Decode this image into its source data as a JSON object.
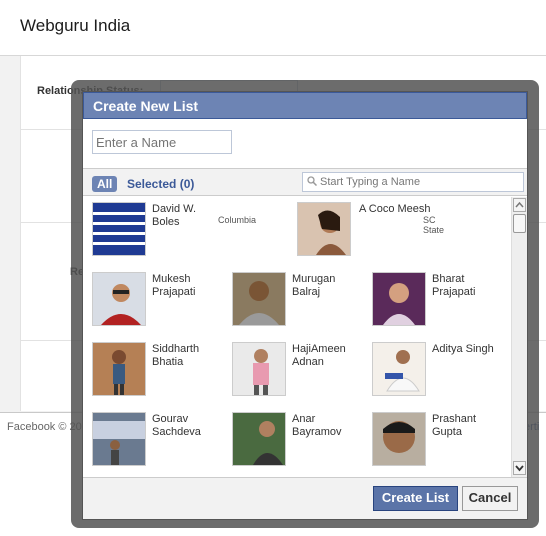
{
  "page": {
    "title": "Webguru India",
    "bg_label_1": "Relationship Status:",
    "bg_label_2": "Re",
    "footer_left": "Facebook © 20",
    "footer_right": "erti"
  },
  "dialog": {
    "title": "Create New List",
    "name_placeholder": "Enter a Name",
    "tab_all": "All",
    "tab_selected": "Selected (0)",
    "search_placeholder": "Start Typing a Name",
    "create_button": "Create List",
    "cancel_button": "Cancel"
  },
  "friends": [
    {
      "name": "David W. Boles",
      "network": "Columbia",
      "avatar": "lines-logo"
    },
    {
      "name": "A Coco Meesh",
      "network": "SC State",
      "avatar": "woman-photo"
    },
    {
      "name": "Mukesh Prajapati",
      "network": "",
      "avatar": "man-sunglasses-photo"
    },
    {
      "name": "Murugan Balraj",
      "network": "",
      "avatar": "man-photo"
    },
    {
      "name": "Bharat Prajapati",
      "network": "",
      "avatar": "child-photo"
    },
    {
      "name": "Siddharth Bhatia",
      "network": "",
      "avatar": "man-photo"
    },
    {
      "name": "HajiAmeen Adnan",
      "network": "",
      "avatar": "man-pink-shirt-photo"
    },
    {
      "name": "Aditya Singh",
      "network": "",
      "avatar": "man-photo"
    },
    {
      "name": "Gourav Sachdeva",
      "network": "",
      "avatar": "group-photo"
    },
    {
      "name": "Anar Bayramov",
      "network": "",
      "avatar": "man-phone-photo"
    },
    {
      "name": "Prashant Gupta",
      "network": "",
      "avatar": "man-closeup-photo"
    }
  ],
  "colors": {
    "header_blue": "#6d84b4",
    "link_blue": "#3b5998",
    "button_blue": "#5b74a8"
  }
}
